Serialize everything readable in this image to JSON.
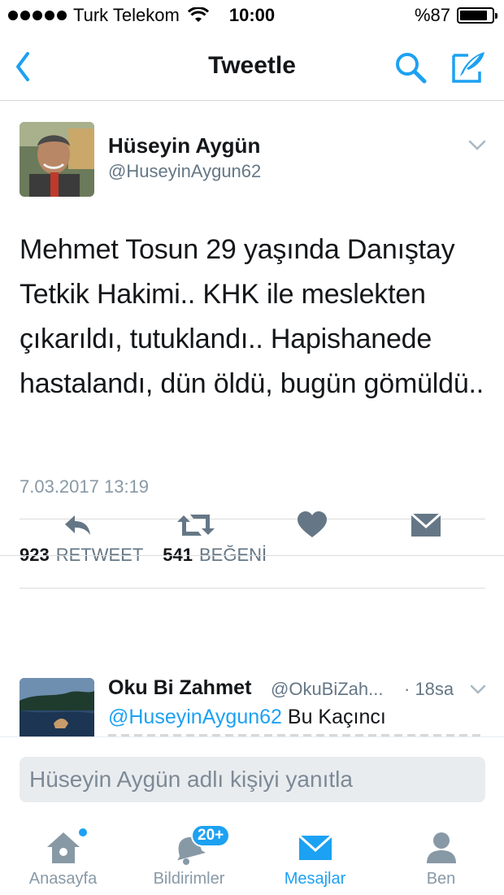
{
  "status_bar": {
    "carrier": "Turk Telekom",
    "time": "10:00",
    "battery_percent": "%87",
    "battery_level": 0.87
  },
  "nav": {
    "title": "Tweetle",
    "back_icon": "chevron-left-icon",
    "search_icon": "search-icon",
    "compose_icon": "compose-icon"
  },
  "tweet": {
    "author_name": "Hüseyin Aygün",
    "author_handle": "@HuseyinAygun62",
    "text": "Mehmet Tosun 29 yaşında Danıştay Tetkik Hakimi.. KHK ile meslekten çıkarıldı, tutuklandı.. Hapishanede hastalandı, dün öldü, bugün gömüldü..",
    "timestamp": "7.03.2017 13:19",
    "retweet_count": "923",
    "retweet_label": "RETWEET",
    "like_count": "541",
    "like_label": "BEĞENİ"
  },
  "reply": {
    "author_name": "Oku Bi Zahmet",
    "author_handle": "@OkuBiZah...",
    "time": "· 18sa",
    "mention": "@HuseyinAygun62",
    "text": "Bu Kaçıncı"
  },
  "reply_bar": {
    "placeholder": "Hüseyin Aygün adlı kişiyi yanıtla"
  },
  "tabs": [
    {
      "label": "Anasayfa",
      "icon": "home-icon"
    },
    {
      "label": "Bildirimler",
      "icon": "bell-icon",
      "badge": "20+"
    },
    {
      "label": "Mesajlar",
      "icon": "envelope-icon"
    },
    {
      "label": "Ben",
      "icon": "person-icon"
    }
  ],
  "colors": {
    "accent": "#1da1f2",
    "text": "#14171a",
    "secondary": "#657786",
    "icon_gray": "#8899a6"
  }
}
